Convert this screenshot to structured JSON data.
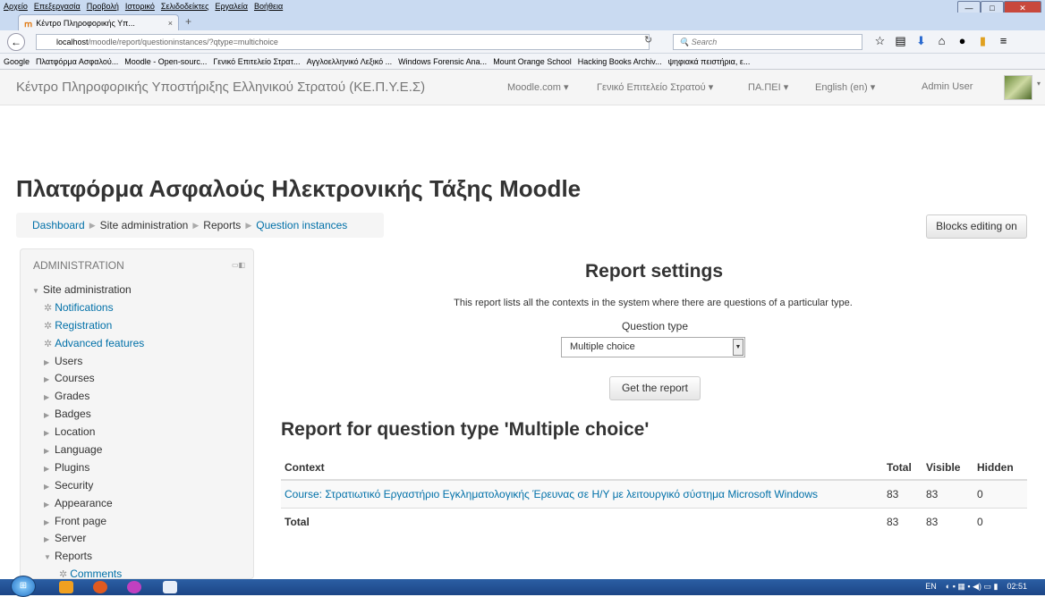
{
  "browser": {
    "menu": [
      "Αρχείο",
      "Επεξεργασία",
      "Προβολή",
      "Ιστορικό",
      "Σελιδοδείκτες",
      "Εργαλεία",
      "Βοήθεια"
    ],
    "tab_title": "Κέντρο Πληροφορικής Υπ...",
    "tab_close": "×",
    "new_tab": "+",
    "url_host": "localhost",
    "url_path": "/moodle/report/questioninstances/?qtype=multichoice",
    "search_placeholder": "Search",
    "bookmarks": [
      "Google",
      "Πλατφόρμα Ασφαλού...",
      "Moodle - Open-sourc...",
      "Γενικό Επιτελείο Στρατ...",
      "Αγγλοελληνικό Λεξικό ...",
      "Windows Forensic Ana...",
      "Mount Orange School",
      "Hacking Books Archiv...",
      "ψηφιακά πειστήρια, ε..."
    ]
  },
  "moodle_nav": {
    "site_name": "Κέντρο Πληροφορικής Υποστήριξης Ελληνικού Στρατού (ΚΕ.Π.Υ.Ε.Σ)",
    "menu": [
      "Moodle.com ▾",
      "Γενικό Επιτελείο Στρατού ▾",
      "ΠΑ.ΠΕΙ ▾",
      "English (en) ▾"
    ],
    "user": "Admin User"
  },
  "page": {
    "heading": "Πλατφόρμα Ασφαλούς Ηλεκτρονικής Τάξης Moodle",
    "breadcrumb": [
      "Dashboard",
      "Site administration",
      "Reports",
      "Question instances"
    ],
    "blocks_editing_button": "Blocks editing on"
  },
  "admin_block": {
    "title": "ADMINISTRATION",
    "root": "Site administration",
    "items": [
      "Notifications",
      "Registration",
      "Advanced features",
      "Users",
      "Courses",
      "Grades",
      "Badges",
      "Location",
      "Language",
      "Plugins",
      "Security",
      "Appearance",
      "Front page",
      "Server",
      "Reports",
      "Comments"
    ]
  },
  "report_settings": {
    "title": "Report settings",
    "description": "This report lists all the contexts in the system where there are questions of a particular type.",
    "question_type_label": "Question type",
    "question_type_value": "Multiple choice",
    "submit_label": "Get the report"
  },
  "report": {
    "title": "Report for question type 'Multiple choice'",
    "columns": [
      "Context",
      "Total",
      "Visible",
      "Hidden"
    ],
    "rows": [
      {
        "context": "Course: Στρατιωτικό Εργαστήριο Εγκληματολογικής Έρευνας σε Η/Υ με λειτουργικό σύστημα Microsoft Windows",
        "total": "83",
        "visible": "83",
        "hidden": "0"
      }
    ],
    "total_row": {
      "label": "Total",
      "total": "83",
      "visible": "83",
      "hidden": "0"
    }
  },
  "taskbar": {
    "lang": "EN",
    "time": "02:51"
  }
}
